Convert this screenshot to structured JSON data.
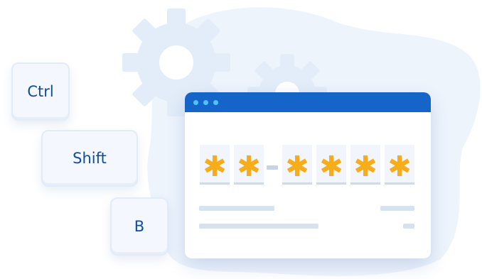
{
  "keys": {
    "ctrl": "Ctrl",
    "shift": "Shift",
    "b": "B"
  },
  "code": {
    "group1": [
      "✱",
      "✱"
    ],
    "group2": [
      "✱",
      "✱",
      "✱",
      "✱"
    ]
  },
  "colors": {
    "titlebar": "#1565c8",
    "window_dots": "#4fc3f7",
    "mask_char": "#f6ad19",
    "key_text": "#0e4da4",
    "background_blob": "#eef4fc",
    "gear": "#e3edf9"
  },
  "icons": [
    "gear-icon",
    "gear-icon"
  ]
}
